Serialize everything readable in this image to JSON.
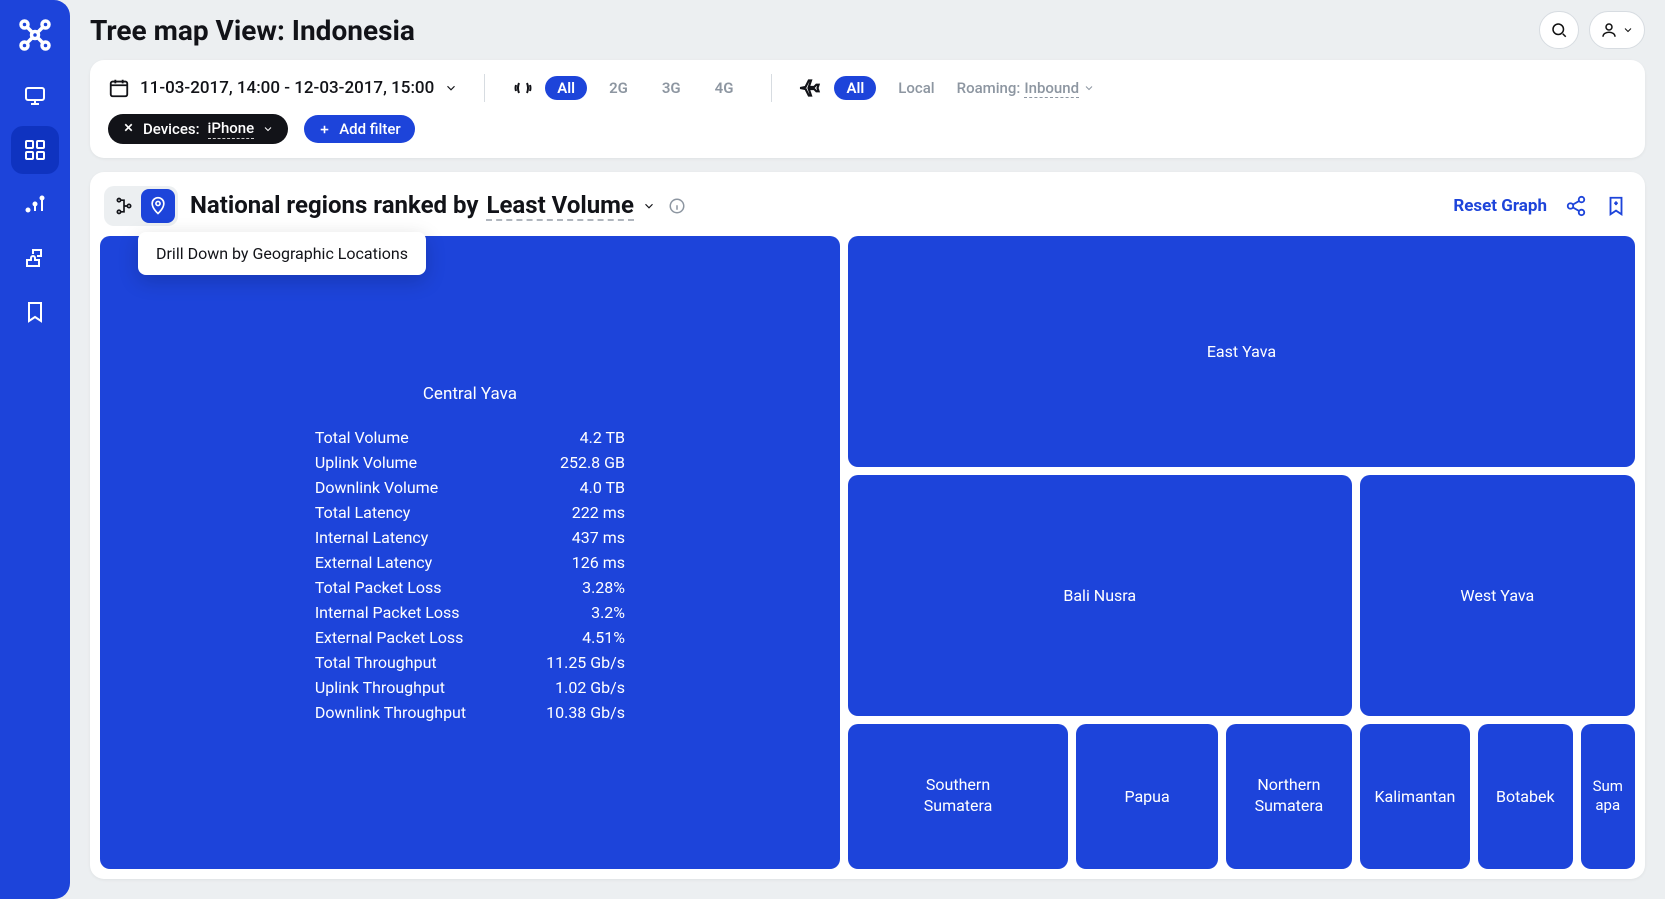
{
  "page_title": "Tree map View: Indonesia",
  "date_range": "11-03-2017, 14:00 - 12-03-2017, 15:00",
  "network_filter": {
    "all": "All",
    "g2": "2G",
    "g3": "3G",
    "g4": "4G"
  },
  "roam_filter": {
    "all": "All",
    "local": "Local",
    "label": "Roaming:",
    "value": "Inbound"
  },
  "device_chip": {
    "label": "Devices:",
    "value": "iPhone"
  },
  "add_filter": "Add filter",
  "header": {
    "title_pre": "National regions ranked by",
    "title_sel": "Least Volume",
    "reset": "Reset Graph"
  },
  "tooltip": "Drill Down by Geographic Locations",
  "big_region": {
    "name": "Central Yava",
    "stats": [
      {
        "k": "Total Volume",
        "v": "4.2 TB"
      },
      {
        "k": "Uplink Volume",
        "v": "252.8 GB"
      },
      {
        "k": "Downlink Volume",
        "v": "4.0 TB"
      },
      {
        "k": "Total Latency",
        "v": "222 ms"
      },
      {
        "k": "Internal Latency",
        "v": "437 ms"
      },
      {
        "k": "External Latency",
        "v": "126 ms"
      },
      {
        "k": "Total Packet Loss",
        "v": "3.28%"
      },
      {
        "k": "Internal Packet Loss",
        "v": "3.2%"
      },
      {
        "k": "External Packet Loss",
        "v": "4.51%"
      },
      {
        "k": "Total Throughput",
        "v": "11.25 Gb/s"
      },
      {
        "k": "Uplink Throughput",
        "v": "1.02 Gb/s"
      },
      {
        "k": "Downlink Throughput",
        "v": "10.38 Gb/s"
      }
    ]
  },
  "regions": {
    "east_yava": "East Yava",
    "bali_nusra": "Bali Nusra",
    "west_yava": "West Yava",
    "southern_sumatera": "Southern Sumatera",
    "papua": "Papua",
    "northern_sumatera": "Northern Sumatera",
    "kalimantan": "Kalimantan",
    "botabek": "Botabek",
    "sumapa": "Sumapa"
  }
}
